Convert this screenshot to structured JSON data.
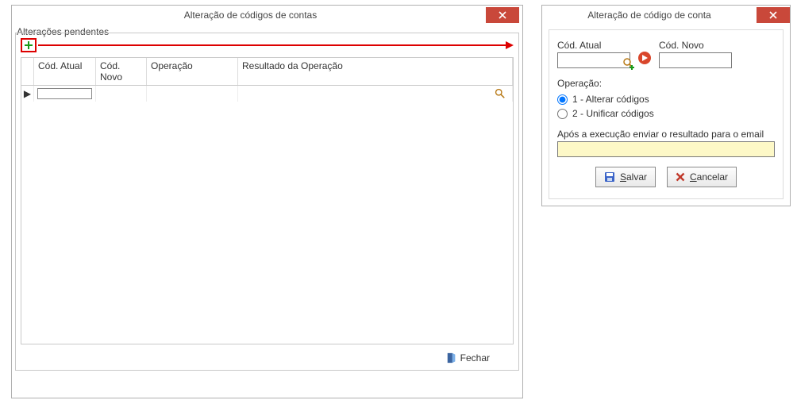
{
  "left": {
    "title": "Alteração de códigos de contas",
    "group_label": "Alterações pendentes",
    "columns": [
      "Cód. Atual",
      "Cód. Novo",
      "Operação",
      "Resultado da Operação"
    ],
    "close_label": "Fechar",
    "active_row_value": ""
  },
  "right": {
    "title": "Alteração de código de conta",
    "labels": {
      "cod_atual": "Cód. Atual",
      "cod_novo": "Cód. Novo",
      "operacao": "Operação:",
      "email": "Após a execução enviar o resultado para o email"
    },
    "values": {
      "cod_atual": "",
      "cod_novo": "",
      "email": ""
    },
    "ops": {
      "opt1": "1 - Alterar códigos",
      "opt2": "2 - Unificar códigos",
      "selected": "opt1"
    },
    "buttons": {
      "save_rest": "alvar",
      "save_u": "S",
      "cancel_rest": "ancelar",
      "cancel_u": "C"
    }
  }
}
